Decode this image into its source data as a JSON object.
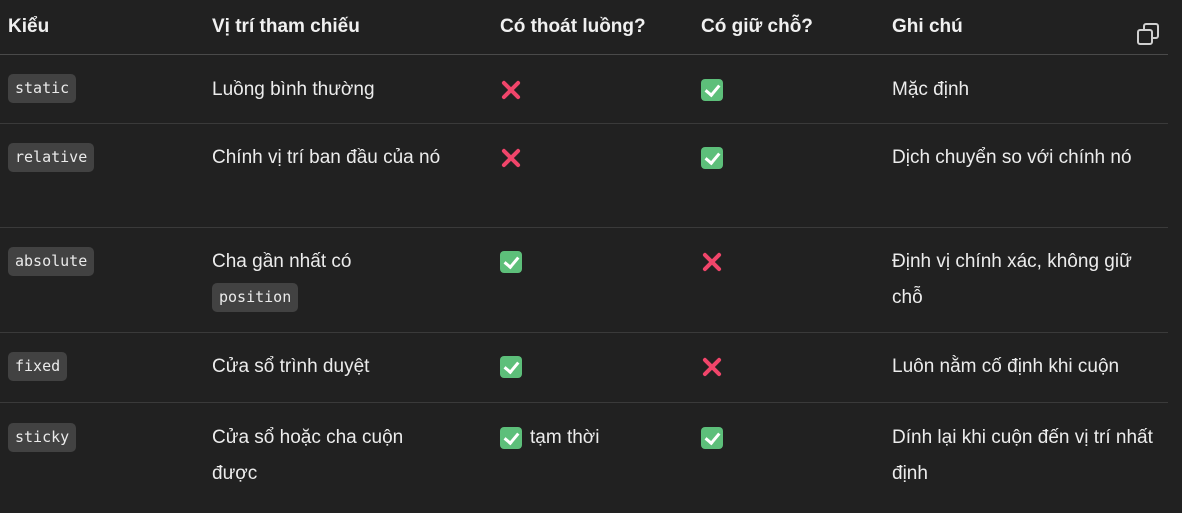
{
  "header": {
    "col_type": "Kiểu",
    "col_reference": "Vị trí tham chiếu",
    "col_out_of_flow": "Có thoát luồng?",
    "col_keeps_space": "Có giữ chỗ?",
    "col_note": "Ghi chú"
  },
  "copy_icon": "copy-icon",
  "rows": [
    {
      "type": "static",
      "reference_text": "Luồng bình thường",
      "out_of_flow": "no",
      "keeps_space": "yes",
      "note": "Mặc định"
    },
    {
      "type": "relative",
      "reference_text": "Chính vị trí ban đầu của nó",
      "out_of_flow": "no",
      "keeps_space": "yes",
      "note": "Dịch chuyển so với chính nó"
    },
    {
      "type": "absolute",
      "reference_text": "Cha gần nhất có",
      "reference_code": "position",
      "out_of_flow": "yes",
      "keeps_space": "no",
      "note": "Định vị chính xác, không giữ chỗ"
    },
    {
      "type": "fixed",
      "reference_text": "Cửa sổ trình duyệt",
      "out_of_flow": "yes",
      "keeps_space": "no",
      "note": "Luôn nằm cố định khi cuộn"
    },
    {
      "type": "sticky",
      "reference_text": "Cửa sổ hoặc cha cuộn được",
      "out_of_flow": "yes",
      "out_of_flow_note": "tạm thời",
      "keeps_space": "yes",
      "note": "Dính lại khi cuộn đến vị trí nhất định"
    }
  ],
  "colors": {
    "background": "#212121",
    "check": "#5dbf7a",
    "cross": "#f0456a",
    "code_bg": "#424242"
  }
}
